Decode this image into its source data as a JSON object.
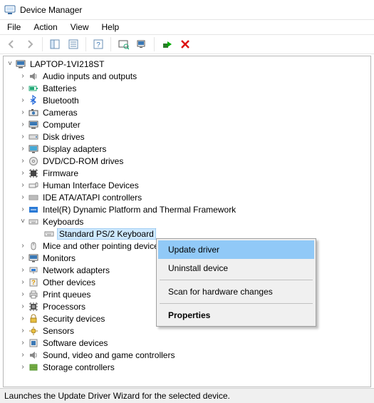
{
  "window": {
    "title": "Device Manager"
  },
  "menubar": {
    "file": "File",
    "action": "Action",
    "view": "View",
    "help": "Help"
  },
  "tree": {
    "root": "LAPTOP-1VI218ST",
    "items": {
      "audio": "Audio inputs and outputs",
      "batteries": "Batteries",
      "bluetooth": "Bluetooth",
      "cameras": "Cameras",
      "computer": "Computer",
      "disk": "Disk drives",
      "display": "Display adapters",
      "dvd": "DVD/CD-ROM drives",
      "firmware": "Firmware",
      "hid": "Human Interface Devices",
      "ide": "IDE ATA/ATAPI controllers",
      "intel": "Intel(R) Dynamic Platform and Thermal Framework",
      "keyboards": "Keyboards",
      "keyboard_child": "Standard PS/2 Keyboard",
      "mice": "Mice and other pointing devices",
      "monitors": "Monitors",
      "network": "Network adapters",
      "other": "Other devices",
      "print": "Print queues",
      "processors": "Processors",
      "security": "Security devices",
      "sensors": "Sensors",
      "software": "Software devices",
      "sound": "Sound, video and game controllers",
      "storage": "Storage controllers"
    }
  },
  "context_menu": {
    "update": "Update driver",
    "uninstall": "Uninstall device",
    "scan": "Scan for hardware changes",
    "properties": "Properties"
  },
  "statusbar": {
    "text": "Launches the Update Driver Wizard for the selected device."
  }
}
